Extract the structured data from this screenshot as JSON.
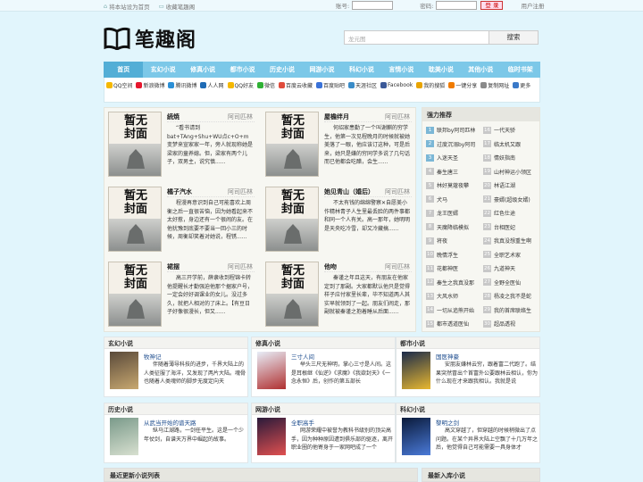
{
  "topbar": {
    "set_home": "将本站设为首页",
    "bookmark": "收藏笔趣阁",
    "account_label": "账号:",
    "password_label": "密码:",
    "login_button": "登 录",
    "register": "用户注册"
  },
  "logo": {
    "text": "笔趣阁"
  },
  "search": {
    "placeholder": "龙元图",
    "button": "搜索"
  },
  "nav": [
    "首页",
    "玄幻小说",
    "修真小说",
    "都市小说",
    "历史小说",
    "网游小说",
    "科幻小说",
    "言情小说",
    "耽美小说",
    "其他小说",
    "临时书架"
  ],
  "share": [
    {
      "label": "QQ空间",
      "color": "#f5b800"
    },
    {
      "label": "新浪微博",
      "color": "#e6162d"
    },
    {
      "label": "腾讯微博",
      "color": "#2b8fd6"
    },
    {
      "label": "人人网",
      "color": "#1f6bb5"
    },
    {
      "label": "QQ好友",
      "color": "#f5b800"
    },
    {
      "label": "微信",
      "color": "#2fb134"
    },
    {
      "label": "百度云收藏",
      "color": "#e04c3c"
    },
    {
      "label": "百度贴吧",
      "color": "#3a72d8"
    },
    {
      "label": "天涯社区",
      "color": "#3a8cc8"
    },
    {
      "label": "Facebook",
      "color": "#3b5998"
    },
    {
      "label": "我的搜狐",
      "color": "#e8a400"
    },
    {
      "label": "一键分享",
      "color": "#f07b00"
    },
    {
      "label": "复制网址",
      "color": "#8a8a8a"
    },
    {
      "label": "更多",
      "color": "#3a79c8"
    }
  ],
  "cover_text": "暂无\n封面",
  "featured": [
    {
      "title": "続焼",
      "author": "阿司匹林",
      "desc": "“看书请到bat+TAng+Shu+WU点c+O+m 变梦来宣家家一年，旁人就现称她是梁家的童养媳。但，梁家有两个儿子，双男主，说究慎......"
    },
    {
      "title": "屋檐绊月",
      "author": "阿司匹林",
      "desc": "何绍家患勤了一个叫谢麒的穷学生，他第一次见程晚月的时候就被她美落了一眼，他应该订这种，可是后来，她只是嫌的穷同学多说了几句话而已他都会吃醋，会生......"
    },
    {
      "title": "橘子汽水",
      "author": "阿司匹林",
      "desc": "程漫再意识到自己可能喜欢上周衡之后一直很苦恼，因为她看起来不太好惹，身边还有一个很闹的友。在他犹豫到底要不要当一回小三的时候，周衡却笑着对她说，程锈......"
    },
    {
      "title": "她见青山（婚后）",
      "author": "阿司匹林",
      "desc": "不太有钱的绵绵警察✕自愿美小作精林青子人生里最丢脸的两件事都和同一个人有关。高一那年，她明明是天央吃冷雪，却又冷藏搞......"
    },
    {
      "title": "裙摆",
      "author": "阿司匹林",
      "desc": "高三开学前，薛隶收到程锦卡转他提醒长才勤强迫他那个据家户号，一定会好好调课业的女儿。没过多久，就把人相对的了床上。【有豆日子好像很漫长，但又......"
    },
    {
      "title": "他吻",
      "author": "阿司匹林",
      "desc": "秦谨之年且这天，有朋友在他家定到了那副。大家都默认他只是觉得样子应付家里长辈，毕不知道两人其实早就领到了一起。朋友们闹走，那副就被秦谨之抱着睡从后面......"
    }
  ],
  "recommend": {
    "title": "强力推荐",
    "left": [
      "联邦by阿司匹林",
      "过度沉溺by阿司",
      "入迷天圣",
      "秦生唐三",
      "林好莫蔻夜攀",
      "犬马",
      "龙王医婿",
      "天魔降临模拟",
      "将夜",
      "晚情浮生",
      "花都神医",
      "秦生之我真没那",
      "大风水师",
      "一切从追熊开始",
      "都市透道医仙"
    ],
    "right": [
      "一代天骄",
      "临太机又跟",
      "情妖指南",
      "山村神运小领区",
      "林语江湖",
      "豪婿(超级女婿)",
      "红色仕途",
      "台相医妃",
      "我真没想重生啊",
      "全职艺术家",
      "九道神天",
      "全野全医仙",
      "杨凌之我不是蛇",
      "我的首席联络生",
      "超品透视"
    ]
  },
  "sections": [
    {
      "head": "玄幻小说",
      "title": "牧神记",
      "desc": "伴随着薄导科技的进步，千界大陆上的人类征服了海洋，又发现了两片大陆。魂骨也随着人类魂师的脚步无度定向天"
    },
    {
      "head": "修真小说",
      "title": "三寸人间",
      "desc": "举头三尺无神明，掌心三寸是人间。这是耳根继《仙逆》《求魔》《我欲封天》《一念永恒》后，创作的第五部长"
    },
    {
      "head": "都市小说",
      "title": "国医神豪",
      "desc": "安朋友嫌林云穷，跟着富二代跑了。结果突然冒出个首富外公要跟林云相认，你为什么现在才来跟我相认。我就是说"
    },
    {
      "head": "历史小说",
      "title": "从武当开始的谱天路",
      "desc": "纵马江湖路，一剑任平生。这是一个少年仗剑，自谱天万界中崛起的故事。"
    },
    {
      "head": "网游小说",
      "title": "全职高手",
      "desc": "网游荣耀中被誉为教科书级别的顶尖高手，因为种种原因遭到俱乐部的驱逐，离开职业圈的他寄身于一家网吧成了一个"
    },
    {
      "head": "科幻小说",
      "title": "黎明之剑",
      "desc": "高文穿越了，但穿越的时候稍微出了点问题。在某个异界大陆上空飘了十几万年之后，他觉得自己可能需要一具身体才"
    }
  ],
  "bottom": {
    "left": "最近更新小说列表",
    "right": "最新入库小说"
  }
}
